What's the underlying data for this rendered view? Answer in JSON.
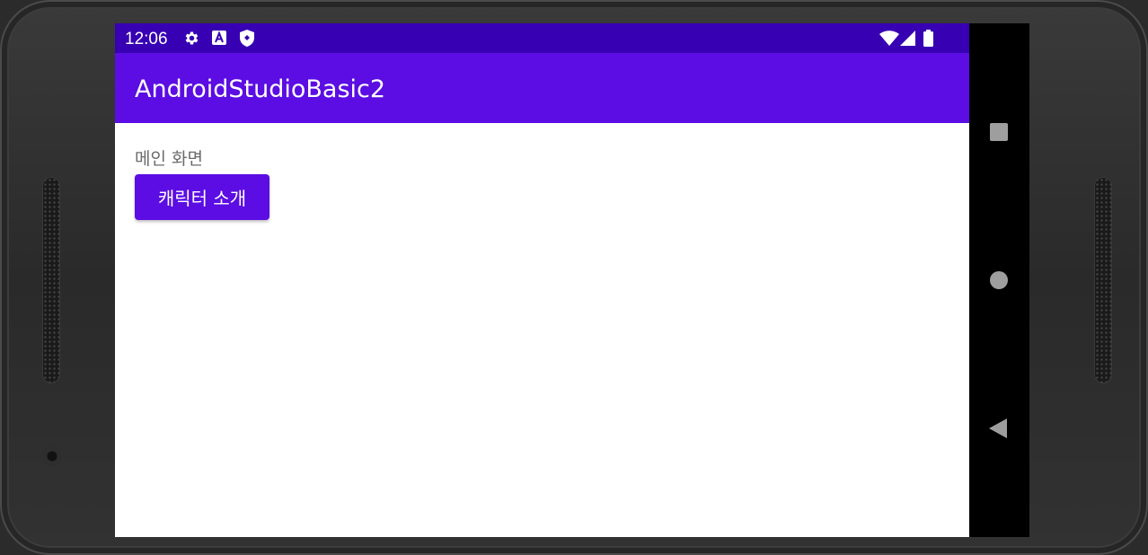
{
  "status_bar": {
    "time": "12:06",
    "left_icons": [
      "gear-icon",
      "a-square-icon",
      "shield-icon"
    ],
    "right_icons": [
      "wifi-icon",
      "signal-icon",
      "battery-icon"
    ],
    "color": "#3700b3"
  },
  "toolbar": {
    "title": "AndroidStudioBasic2",
    "color": "#5b0de3"
  },
  "content": {
    "label": "메인 화면",
    "button_label": "캐릭터 소개"
  },
  "nav_bar": {
    "icons": [
      "recents-square-icon",
      "home-circle-icon",
      "back-triangle-icon"
    ]
  }
}
